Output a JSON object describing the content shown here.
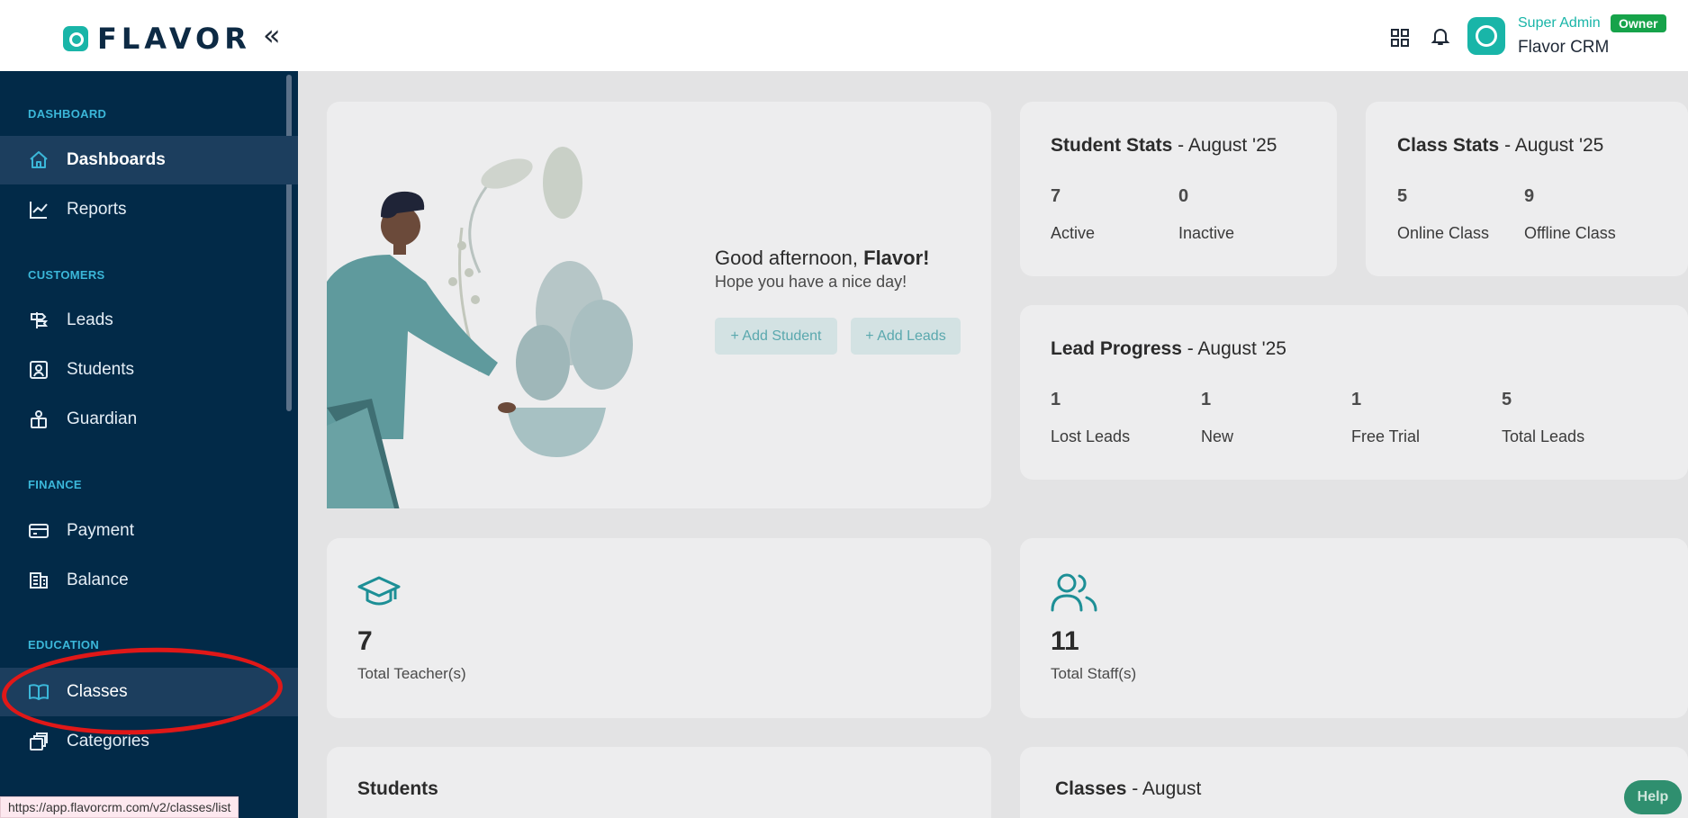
{
  "header": {
    "logo_text": "FLAVOR",
    "collapse_icon": "«",
    "user_role": "Super Admin",
    "owner_badge": "Owner",
    "company": "Flavor CRM"
  },
  "sidebar": {
    "sections": [
      {
        "label": "DASHBOARD"
      },
      {
        "label": "CUSTOMERS"
      },
      {
        "label": "FINANCE"
      },
      {
        "label": "EDUCATION"
      }
    ],
    "items": [
      {
        "label": "Dashboards",
        "icon": "home-icon"
      },
      {
        "label": "Reports",
        "icon": "chart-line-icon"
      },
      {
        "label": "Leads",
        "icon": "signpost-icon"
      },
      {
        "label": "Students",
        "icon": "user-square-icon"
      },
      {
        "label": "Guardian",
        "icon": "guardian-icon"
      },
      {
        "label": "Payment",
        "icon": "card-icon"
      },
      {
        "label": "Balance",
        "icon": "balance-icon"
      },
      {
        "label": "Classes",
        "icon": "book-icon"
      },
      {
        "label": "Categories",
        "icon": "layers-icon"
      }
    ]
  },
  "welcome": {
    "greeting_prefix": "Good afternoon, ",
    "greeting_name": "Flavor!",
    "subtitle": "Hope you have a nice day!",
    "add_student": "+ Add Student",
    "add_leads": "+ Add Leads"
  },
  "student_stats": {
    "title": "Student Stats",
    "period": " - August '25",
    "items": [
      {
        "value": "7",
        "label": "Active"
      },
      {
        "value": "0",
        "label": "Inactive"
      }
    ]
  },
  "class_stats": {
    "title": "Class Stats",
    "period": " - August '25",
    "items": [
      {
        "value": "5",
        "label": "Online Class"
      },
      {
        "value": "9",
        "label": "Offline Class"
      }
    ]
  },
  "lead_progress": {
    "title": "Lead Progress",
    "period": " - August '25",
    "items": [
      {
        "value": "1",
        "label": "Lost Leads"
      },
      {
        "value": "1",
        "label": "New"
      },
      {
        "value": "1",
        "label": "Free Trial"
      },
      {
        "value": "5",
        "label": "Total Leads"
      }
    ]
  },
  "teachers": {
    "value": "7",
    "label": "Total Teacher(s)"
  },
  "staff": {
    "value": "11",
    "label": "Total Staff(s)"
  },
  "students_section": {
    "title": "Students"
  },
  "classes_section": {
    "title": "Classes",
    "period": " - August"
  },
  "status_url": "https://app.flavorcrm.com/v2/classes/list",
  "help_label": "Help",
  "colors": {
    "sidebar_bg": "#022a48",
    "accent": "#19b5a8",
    "section_label": "#3bb7d9",
    "owner_badge": "#16a34a",
    "annotation_red": "#e01818"
  }
}
